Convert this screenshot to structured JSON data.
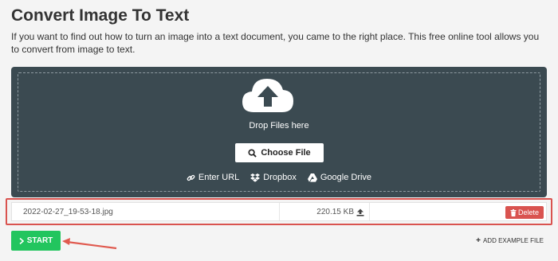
{
  "page": {
    "title": "Convert Image To Text",
    "description": "If you want to find out how to turn an image into a text document, you came to the right place. This free online tool allows you to convert from image to text."
  },
  "dropzone": {
    "drop_text": "Drop Files here",
    "choose_file_label": "Choose File",
    "sources": [
      {
        "label": "Enter URL",
        "icon": "link-icon"
      },
      {
        "label": "Dropbox",
        "icon": "dropbox-icon"
      },
      {
        "label": "Google Drive",
        "icon": "google-drive-icon"
      }
    ]
  },
  "file": {
    "name": "2022-02-27_19-53-18.jpg",
    "size": "220.15 KB",
    "delete_label": "Delete"
  },
  "actions": {
    "start_label": "START",
    "add_example_label": "ADD EXAMPLE FILE"
  },
  "colors": {
    "dropzone_bg": "#3b4a51",
    "delete_red": "#d9534f",
    "start_green": "#22c55e",
    "highlight_red": "#d9534f"
  }
}
